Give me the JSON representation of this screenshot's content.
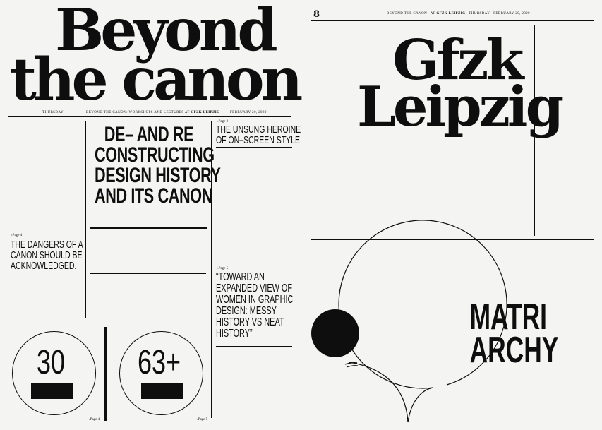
{
  "left_page": {
    "masthead_line1": "Beyond",
    "masthead_line2": "the canon",
    "dateline": {
      "day": "THURSDAY",
      "event": "BEYOND THE CANON: WORKSHOPS AND LECTURES AT",
      "venue": "GFZK LEIPZIG",
      "date": "FEBRUARY 20, 2020"
    },
    "main_headline": [
      "DE– AND RE",
      "CONSTRUCTING",
      "DESIGN HISTORY",
      "AND ITS CANON"
    ],
    "story_page2": {
      "ref": "›Page 2",
      "lines": [
        "THE UNSUNG HEROINE",
        "OF ON–SCREEN STYLE"
      ]
    },
    "story_page4": {
      "ref": "›Page 4",
      "lines": [
        "THE DANGERS OF A",
        "CANON SHOULD BE",
        "ACKNOWLEDGED."
      ]
    },
    "story_page5": {
      "ref": "›Page 5",
      "lines": [
        "“TOWARD AN",
        "EXPANDED VIEW OF",
        "WOMEN IN GRAPHIC",
        "DESIGN: MESSY",
        "HISTORY VS NEAT",
        "HISTORY”"
      ]
    },
    "stat_1": {
      "value": "30",
      "ref": "›Page 4"
    },
    "stat_2": {
      "value": "63+",
      "ref": "›Page 5"
    }
  },
  "right_page": {
    "page_number": "8",
    "running_head": {
      "title": "BEYOND THE CANON",
      "at": "AT",
      "venue": "GFZK LEIPZIG",
      "day": "THURSDAY",
      "date": "FEBRUARY 20, 2020"
    },
    "title_line1": "Gfzk",
    "title_line2": "Leipzig",
    "bubble_line1": "MATRI",
    "bubble_line2": "ARCHY"
  }
}
